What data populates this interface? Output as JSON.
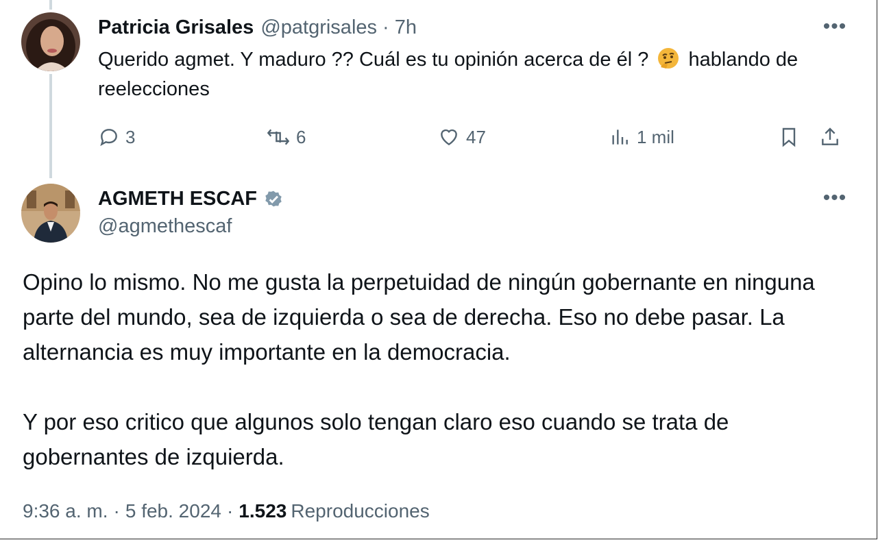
{
  "reply_tweet": {
    "author_name": "Patricia Grisales",
    "author_handle": "@patgrisales",
    "separator": "·",
    "time_ago": "7h",
    "text_part1": "Querido agmet.  Y maduro ?? Cuál es tu opinión acerca de él ?",
    "text_part2": "hablando de reelecciones",
    "emoji": "thinking-face",
    "more_label": "•••",
    "actions": {
      "replies": "3",
      "retweets": "6",
      "likes": "47",
      "views": "1 mil"
    }
  },
  "main_tweet": {
    "author_name": "AGMETH ESCAF",
    "author_handle": "@agmethescaf",
    "verified": true,
    "more_label": "•••",
    "paragraph1": "Opino lo mismo. No me gusta la perpetuidad de ningún gobernante en ninguna parte del mundo, sea de izquierda o sea de derecha. Eso no debe pasar. La alternancia es muy importante en la democracia.",
    "paragraph2": "Y por eso critico que algunos solo tengan claro eso cuando se trata de gobernantes de izquierda.",
    "meta": {
      "time": "9:36 a. m.",
      "sep": "·",
      "date": "5 feb. 2024",
      "views_count": "1.523",
      "views_label": "Reproducciones"
    }
  },
  "colors": {
    "text_primary": "#0f1419",
    "text_secondary": "#536471",
    "thread_line": "#cfd9de",
    "verified_badge": "#829aab"
  }
}
